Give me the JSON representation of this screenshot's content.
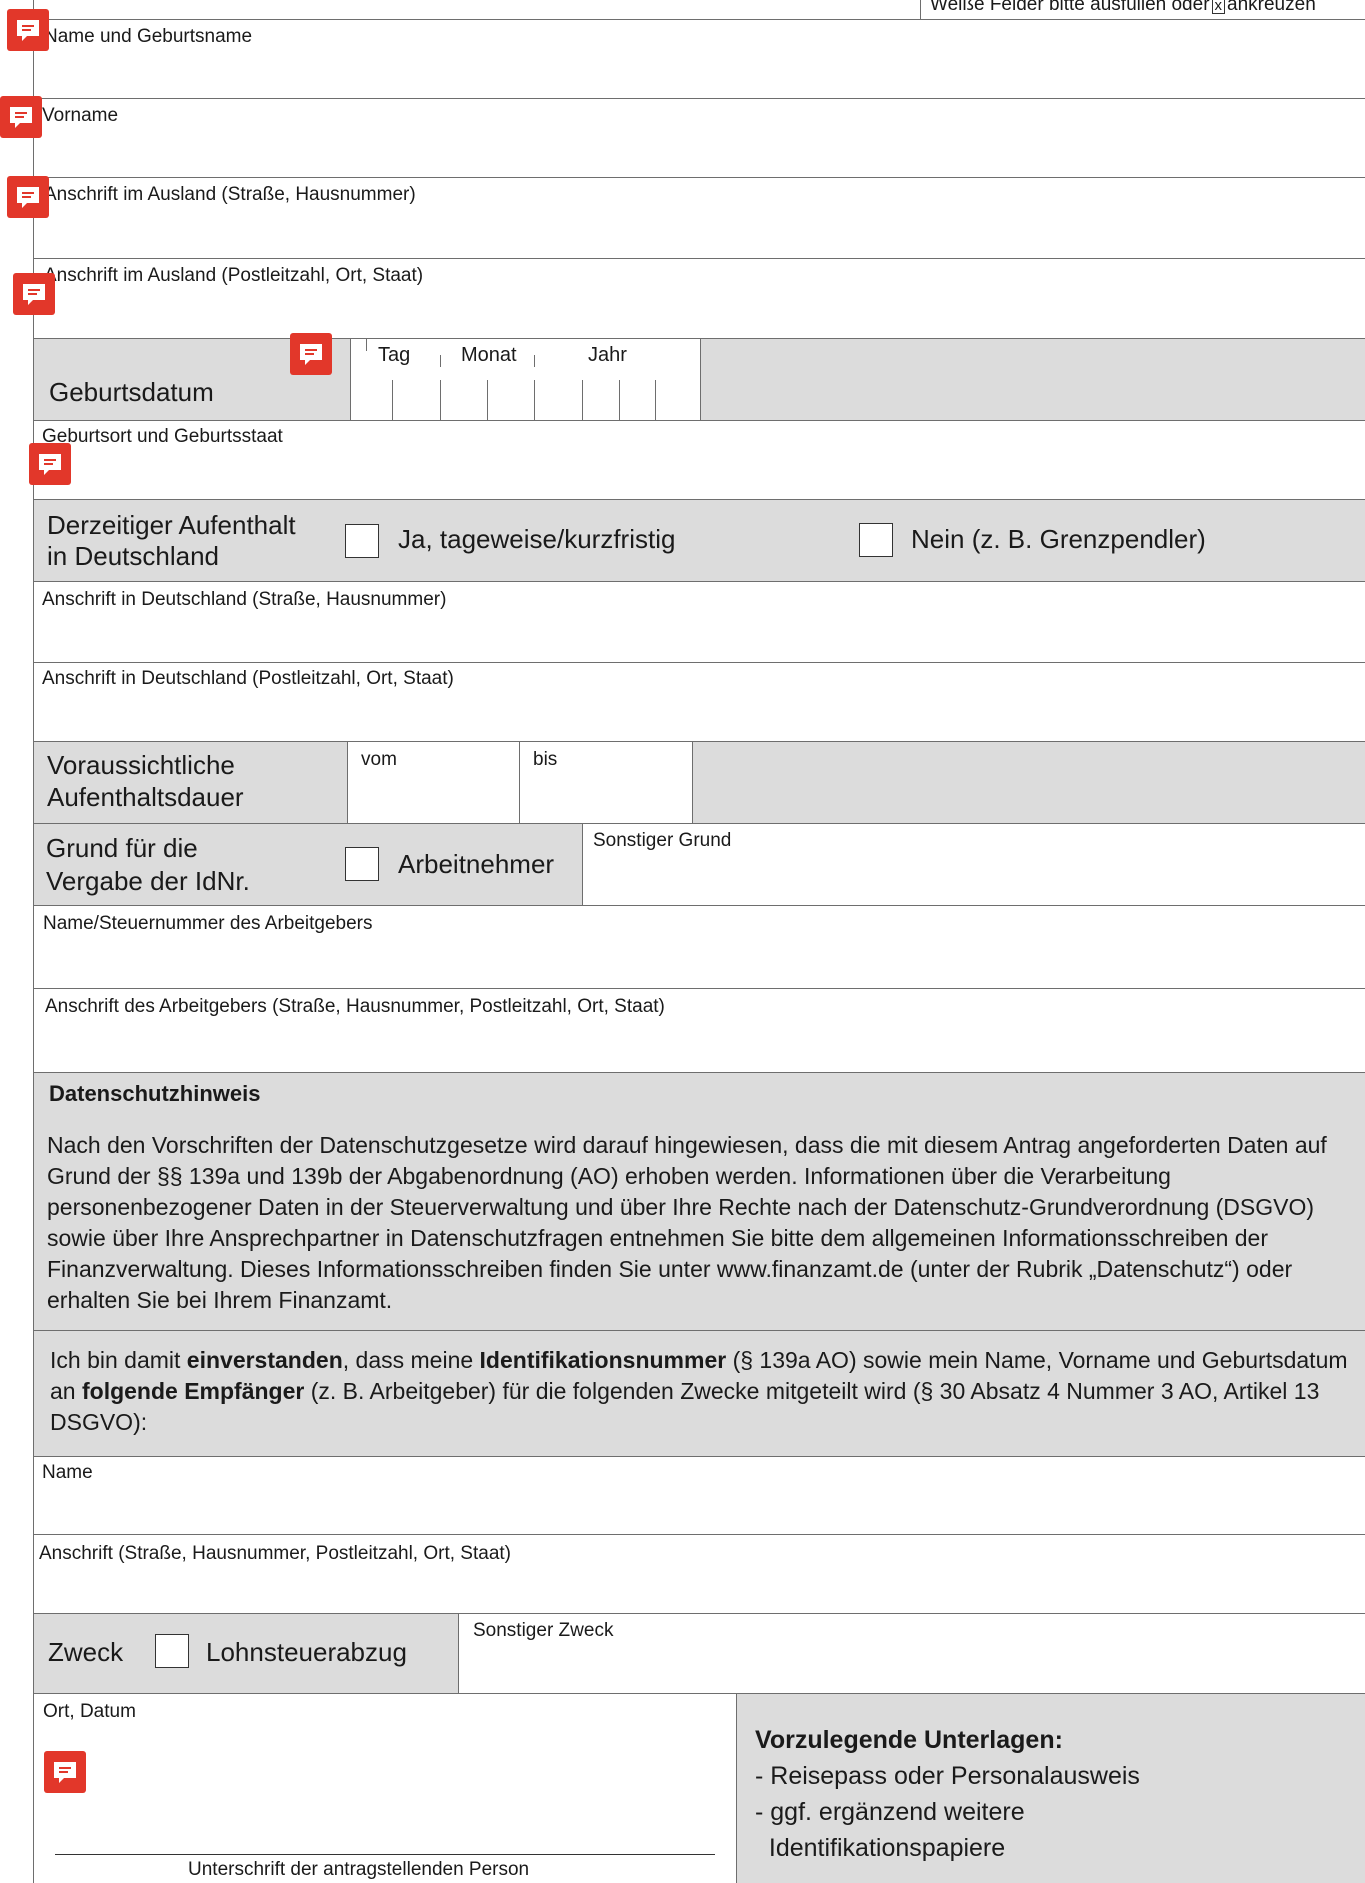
{
  "header": {
    "hint_pre": "Weiße Felder bitte ausfüllen oder",
    "hint_box": "x",
    "hint_post": "ankreuzen"
  },
  "fields": {
    "name": "Name und Geburtsname",
    "vorname": "Vorname",
    "anschrift_ausland_strasse": "Anschrift im Ausland (Straße, Hausnummer)",
    "anschrift_ausland_ort": "Anschrift im Ausland (Postleitzahl, Ort, Staat)",
    "geburtsdatum": "Geburtsdatum",
    "tag": "Tag",
    "monat": "Monat",
    "jahr": "Jahr",
    "geburtsort": "Geburtsort und Geburtsstaat",
    "aufenthalt_l1": "Derzeitiger Aufenthalt",
    "aufenthalt_l2": "in Deutschland",
    "opt_ja": "Ja, tageweise/kurzfristig",
    "opt_nein": "Nein (z. B. Grenzpendler)",
    "anschrift_de_strasse": "Anschrift in Deutschland (Straße, Hausnummer)",
    "anschrift_de_ort": "Anschrift in Deutschland (Postleitzahl, Ort, Staat)",
    "dauer_l1": "Voraussichtliche",
    "dauer_l2": "Aufenthaltsdauer",
    "vom": "vom",
    "bis": "bis",
    "grund_l1": "Grund für die",
    "grund_l2": "Vergabe der IdNr.",
    "arbeitnehmer": "Arbeitnehmer",
    "sonstiger_grund": "Sonstiger Grund",
    "arbeitgeber_name": "Name/Steuernummer des Arbeitgebers",
    "arbeitgeber_anschrift": "Anschrift des Arbeitgebers (Straße, Hausnummer, Postleitzahl, Ort, Staat)"
  },
  "datenschutz": {
    "title": "Datenschutzhinweis",
    "text": "Nach den Vorschriften der Datenschutzgesetze wird darauf hingewiesen, dass die mit diesem Antrag angeforderten Daten auf Grund der §§ 139a und 139b der Abgabenordnung (AO) erhoben werden. Informationen über die Verarbeitung personenbezogener Daten in der Steuerverwaltung und über Ihre Rechte nach der Datenschutz-Grundverordnung (DSGVO) sowie über Ihre Ansprechpartner in Datenschutzfragen entnehmen Sie bitte dem allgemeinen Informationsschreiben der Finanzverwaltung. Dieses Informationsschreiben finden Sie unter www.finanzamt.de (unter der Rubrik „Datenschutz“) oder erhalten Sie bei Ihrem Finanzamt."
  },
  "consent": {
    "p1": "Ich bin damit ",
    "b1": "einverstanden",
    "p2": ", dass meine ",
    "b2": "Identifikationsnummer",
    "p3": " (§ 139a AO) sowie mein Name, Vorname und Geburtsdatum an ",
    "b3": "folgende Empfänger",
    "p4": " (z. B. Arbeitgeber) für die folgenden Zwecke mitgeteilt wird (§ 30 Absatz 4 Nummer 3 AO, Artikel 13 DSGVO):"
  },
  "empfaenger": {
    "name": "Name",
    "anschrift": "Anschrift (Straße, Hausnummer, Postleitzahl, Ort, Staat)",
    "zweck": "Zweck",
    "lohnsteuer": "Lohnsteuerabzug",
    "sonstiger_zweck": "Sonstiger Zweck"
  },
  "footer": {
    "ort_datum": "Ort, Datum",
    "unterschrift": "Unterschrift der antragstellenden Person",
    "docs_title": "Vorzulegende Unterlagen:",
    "docs_1": "- Reisepass oder Personalausweis",
    "docs_2": "- ggf. ergänzend weitere",
    "docs_3": "  Identifikationspapiere"
  },
  "colors": {
    "band": "#dcdcdc",
    "comment": "#e2372a",
    "line": "#6e6e6e"
  },
  "icons": [
    "comment-icon"
  ]
}
